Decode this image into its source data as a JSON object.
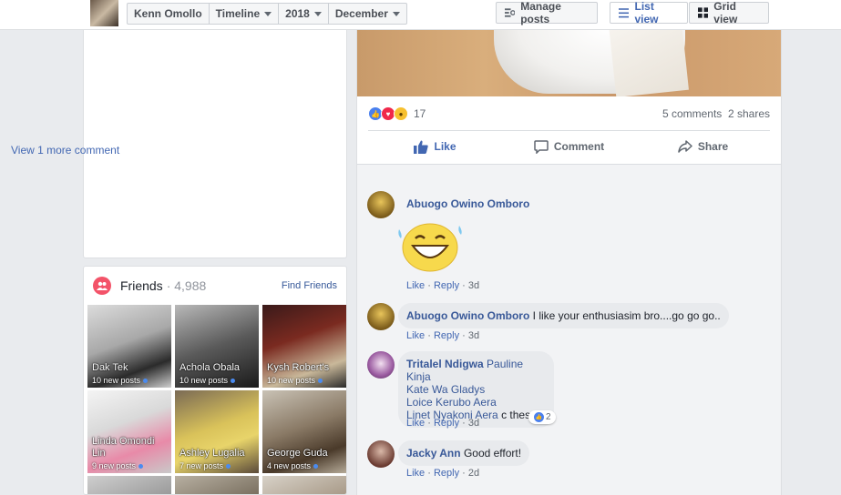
{
  "topbar": {
    "profile_name": "Kenn Omollo",
    "section": "Timeline",
    "year": "2018",
    "month": "December",
    "manage_posts": "Manage posts",
    "list_view": "List view",
    "grid_view": "Grid view"
  },
  "friends": {
    "title": "Friends",
    "count": "· 4,988",
    "find": "Find Friends",
    "items": [
      {
        "name": "Dak Tek",
        "posts": "10 new posts"
      },
      {
        "name": "Achola Obala",
        "posts": "10 new posts"
      },
      {
        "name": "Kysh Robert's",
        "posts": "10 new posts"
      },
      {
        "name": "Linda Omondi Lin",
        "posts": "9 new posts"
      },
      {
        "name": "Ashley Lugalia",
        "posts": "7 new posts"
      },
      {
        "name": "George Guda",
        "posts": "4 new posts"
      }
    ]
  },
  "post": {
    "reaction_count": "17",
    "comments": "5 comments",
    "shares": "2 shares",
    "like": "Like",
    "comment": "Comment",
    "share": "Share",
    "view_more": "View 1 more comment"
  },
  "comments": [
    {
      "author": "Abuogo Owino Omboro",
      "text": "",
      "like": "Like",
      "reply": "Reply",
      "time": "3d"
    },
    {
      "author": "Abuogo Owino Omboro",
      "text": "I like your enthusiasim bro....go go go..",
      "like": "Like",
      "reply": "Reply",
      "time": "3d"
    },
    {
      "author": "Tritalel Ndigwa",
      "mention1": "Pauline Kinja",
      "mention2": "Kate Wa Gladys",
      "mention3": "Loice Kerubo Aera",
      "mention4": "Linet Nyakoni Aera",
      "text": " c these",
      "reactions": "2",
      "like": "Like",
      "reply": "Reply",
      "time": "3d"
    },
    {
      "author": "Jacky Ann",
      "text": "Good effort!",
      "like": "Like",
      "reply": "Reply",
      "time": "2d"
    }
  ],
  "colors": {
    "brand": "#4267b2",
    "link": "#385898",
    "friends_icon": "#f35369"
  }
}
